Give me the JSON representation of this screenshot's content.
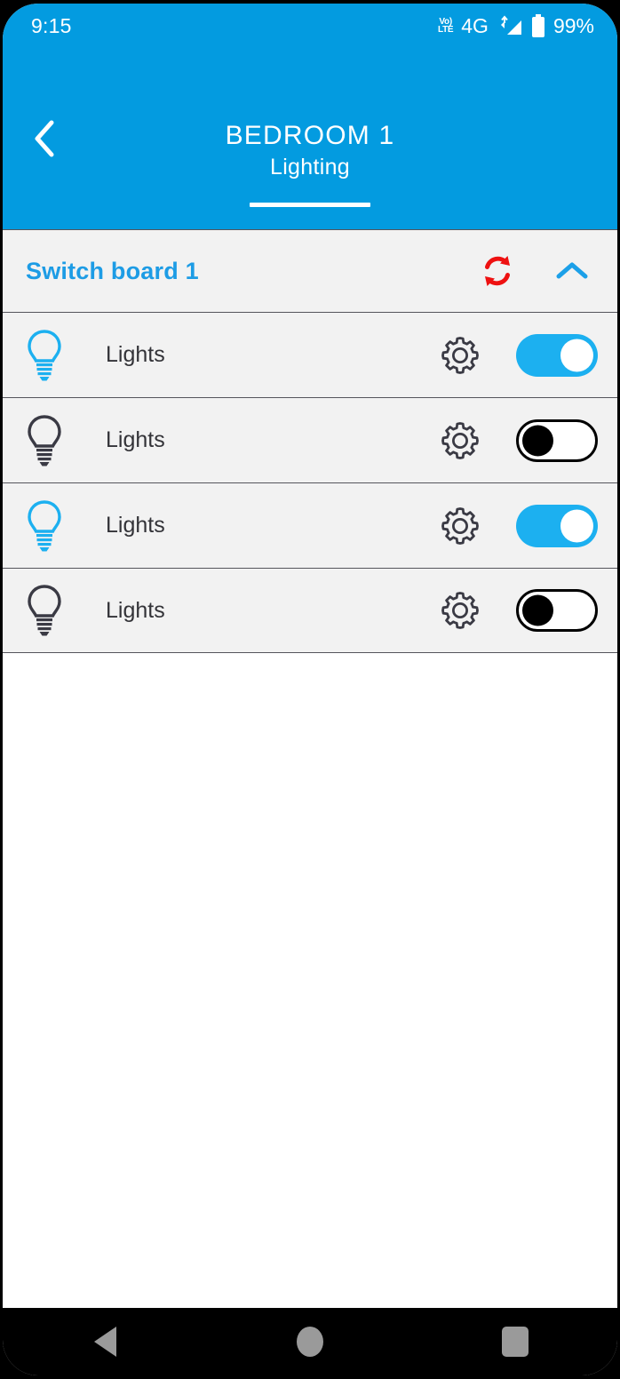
{
  "statusbar": {
    "time": "9:15",
    "volte_top": "Vo)",
    "volte_bottom": "LTE",
    "network": "4G",
    "battery": "99%"
  },
  "appbar": {
    "title": "BEDROOM 1",
    "back_label": "Back",
    "tabs": [
      {
        "label": "Lighting",
        "selected": true
      }
    ]
  },
  "group": {
    "title": "Switch board 1",
    "refresh_label": "Refresh",
    "collapse_label": "Collapse"
  },
  "devices": [
    {
      "label": "Lights",
      "state": "on",
      "settings_label": "Settings"
    },
    {
      "label": "Lights",
      "state": "off",
      "settings_label": "Settings"
    },
    {
      "label": "Lights",
      "state": "on",
      "settings_label": "Settings"
    },
    {
      "label": "Lights",
      "state": "off",
      "settings_label": "Settings"
    }
  ],
  "navbar": {
    "back": "Back",
    "home": "Home",
    "recents": "Recent apps"
  },
  "colors": {
    "brand_blue": "#039BE0",
    "accent_blue": "#1CB0F0",
    "group_title_blue": "#1D9CE5",
    "refresh_red": "#EE1111",
    "row_bg": "#F2F2F2",
    "icon_dark": "#3A3A44"
  }
}
